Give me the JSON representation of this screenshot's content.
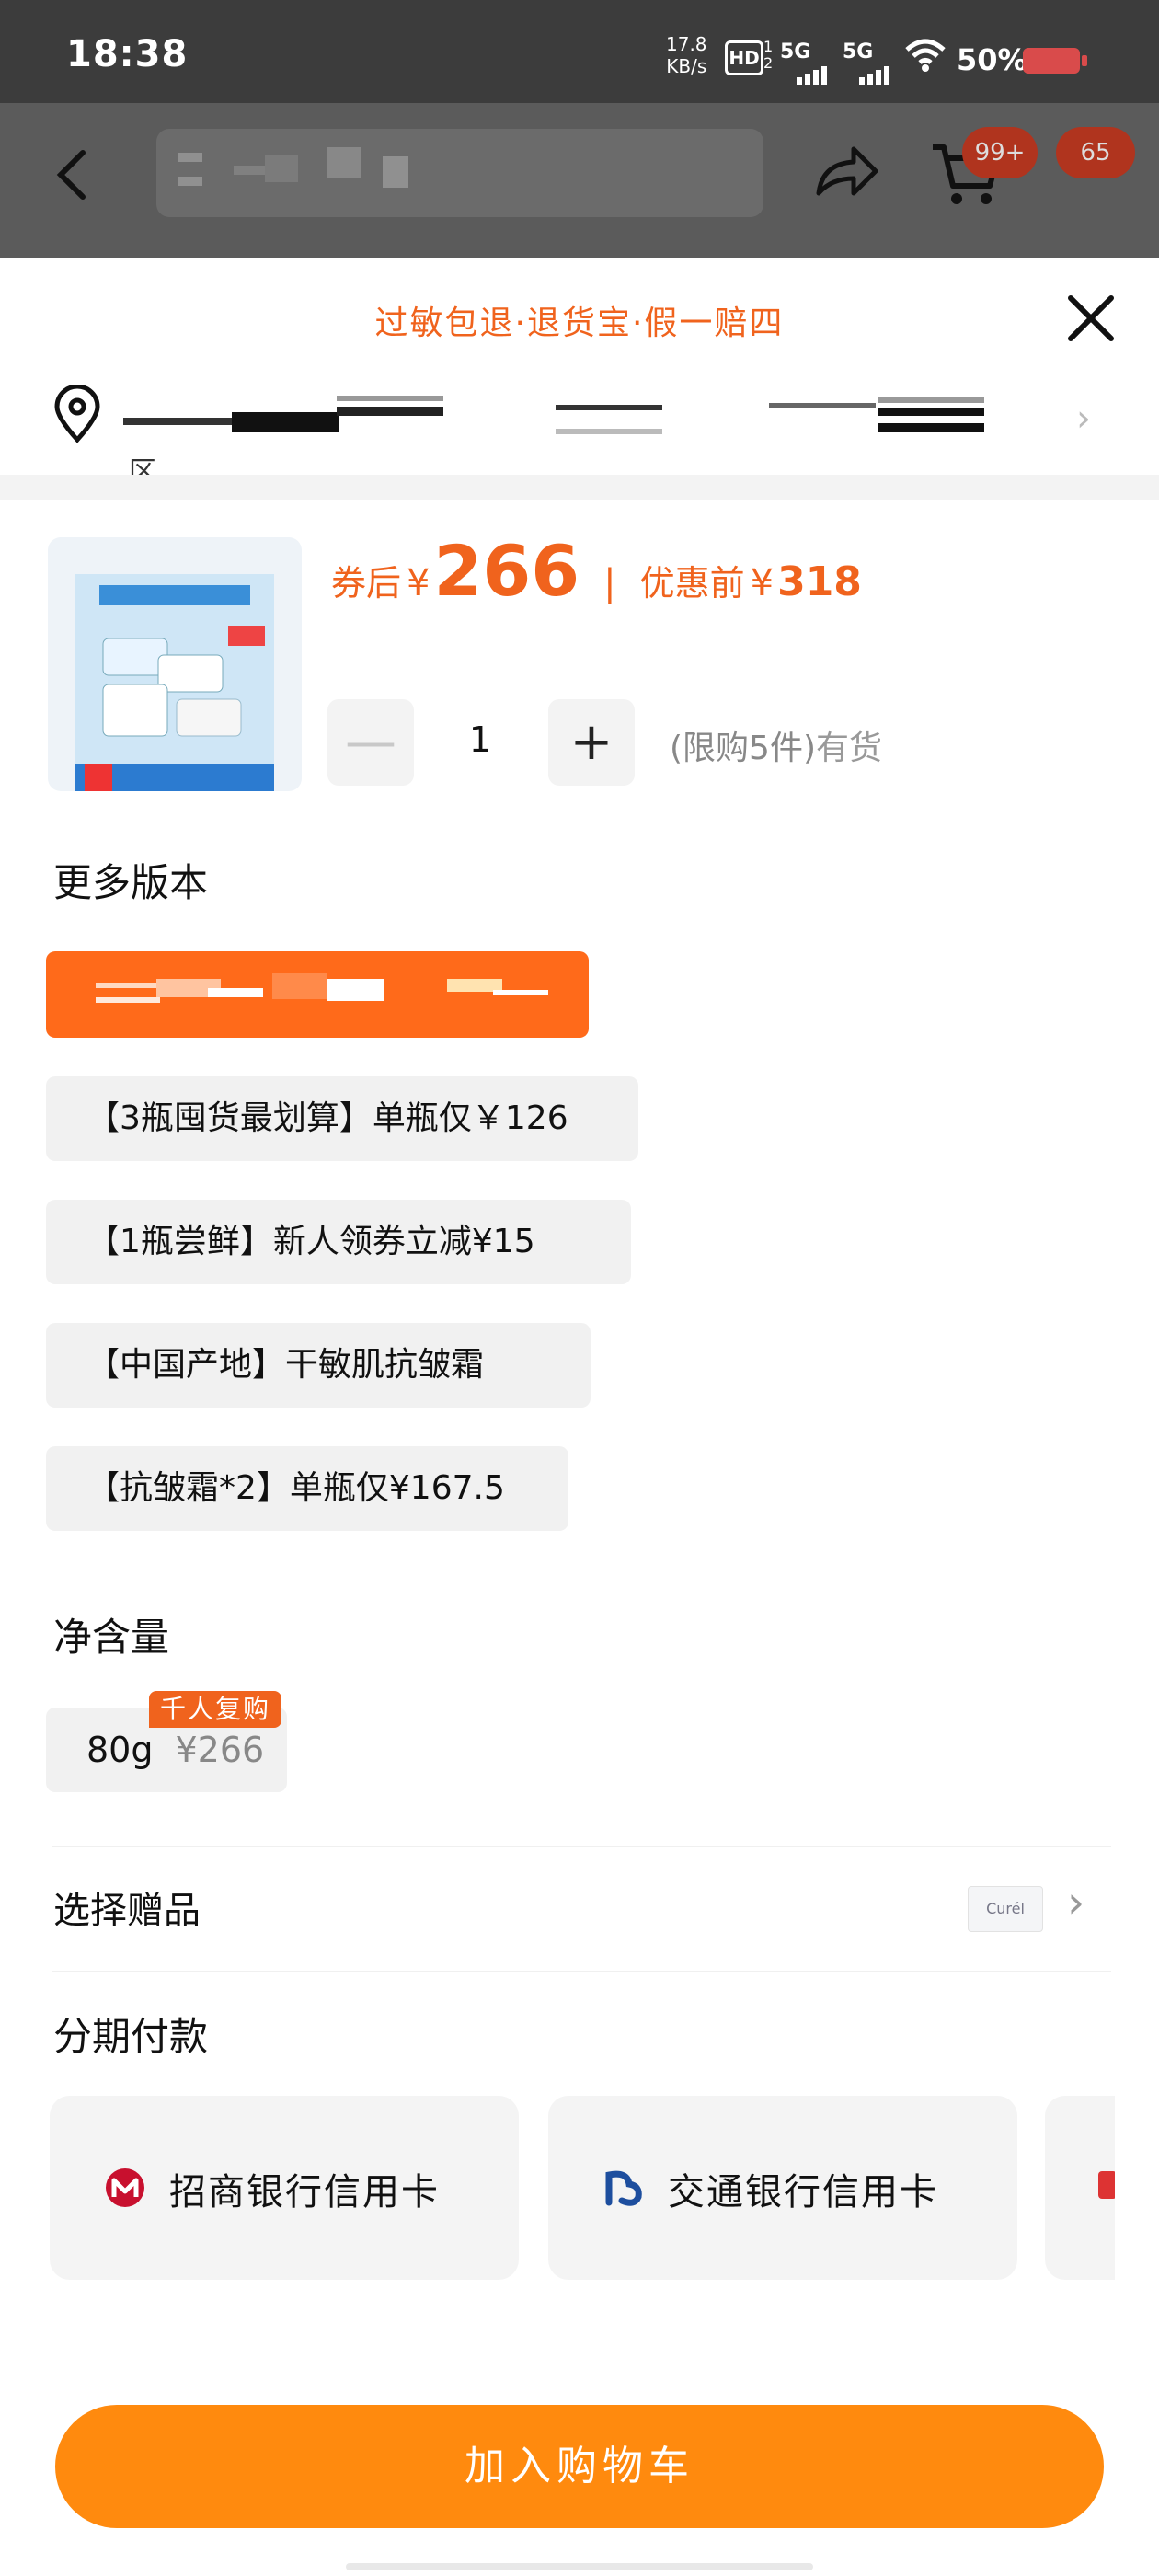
{
  "status_bar": {
    "time": "18:38",
    "net_speed_value": "17.8",
    "net_speed_unit": "KB/s",
    "hd_label": "HD",
    "sim_index": "1 2",
    "sig1": "5G",
    "sig2": "5G",
    "battery": "50%"
  },
  "nav": {
    "badge_cart": "99+",
    "badge_msg": "65"
  },
  "sheet": {
    "guarantee": "过敏包退·退货宝·假一赔四",
    "address_sub": "区"
  },
  "product": {
    "price_label": "券后",
    "yen": "¥",
    "price": "266",
    "sep": "|",
    "orig_label": "优惠前",
    "orig_price": "318",
    "minus": "—",
    "qty": "1",
    "plus": "+",
    "limit": "(限购5件)",
    "stock": "有货"
  },
  "versions": {
    "title": "更多版本",
    "options": [
      "【3瓶囤货最划算】单瓶仅￥126",
      "【1瓶尝鲜】新人领券立减¥15",
      "【中国产地】干敏肌抗皱霜",
      "【抗皱霜*2】单瓶仅¥167.5"
    ]
  },
  "net": {
    "title": "净含量",
    "option": "80g",
    "option_price": "¥266",
    "tag": "千人复购"
  },
  "gift": {
    "label": "选择赠品",
    "thumb_text": "Curél"
  },
  "installment": {
    "title": "分期付款",
    "cards": [
      "招商银行信用卡",
      "交通银行信用卡"
    ]
  },
  "cta": {
    "label": "加入购物车"
  },
  "colors": {
    "accent": "#f0631d",
    "cta": "#ff8a0e",
    "selected_option": "#ff6a1a"
  },
  "icons": [
    "back-icon",
    "share-icon",
    "cart-icon",
    "close-icon",
    "location-pin-icon",
    "chevron-right-icon",
    "cmb-bank-icon",
    "bocom-bank-icon",
    "wifi-icon"
  ]
}
